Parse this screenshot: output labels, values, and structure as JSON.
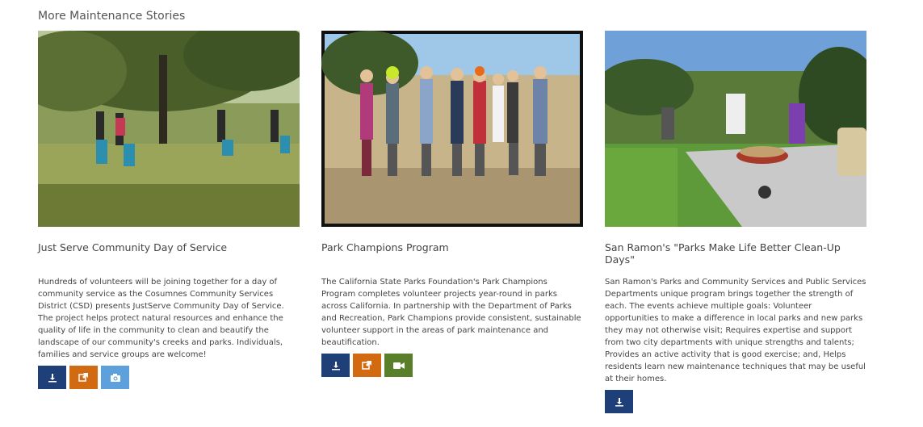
{
  "section": {
    "title": "More Maintenance Stories"
  },
  "colors": {
    "download": "#1f3f78",
    "link": "#d26a12",
    "photo": "#5ea0dc",
    "video": "#5a7f2a"
  },
  "cards": [
    {
      "title": "Just Serve Community Day of Service",
      "description": "Hundreds of volunteers will be joining together for a day of community service as the Cosumnes Community Services District (CSD) presents JustServe Community Day of Service. The project helps protect natural resources and enhance the quality of life in the community to clean and beautify the landscape of our community's creeks and parks. Individuals, families and service groups are welcome!",
      "buttons": [
        "download-icon",
        "external-link-icon",
        "camera-icon"
      ]
    },
    {
      "title": "Park Champions Program",
      "description": "The California State Parks Foundation's Park Champions Program completes volunteer projects year-round in parks across California. In partnership with the Department of Parks and Recreation, Park Champions provide consistent, sustainable volunteer support in the areas of park maintenance and beautification.",
      "buttons": [
        "download-icon",
        "external-link-icon",
        "video-camera-icon"
      ]
    },
    {
      "title": "San Ramon's \"Parks Make Life Better Clean-Up Days\"",
      "description": "San Ramon's Parks and Community Services and Public Services Departments unique program brings together the strength of each. The events achieve multiple goals: Volunteer opportunities to make a difference in local parks and new parks they may not otherwise visit; Requires expertise and support from two city departments with unique strengths and talents; Provides an active activity that is good exercise; and, Helps residents learn new maintenance techniques that may be useful at their homes.",
      "buttons": [
        "download-icon"
      ]
    }
  ]
}
